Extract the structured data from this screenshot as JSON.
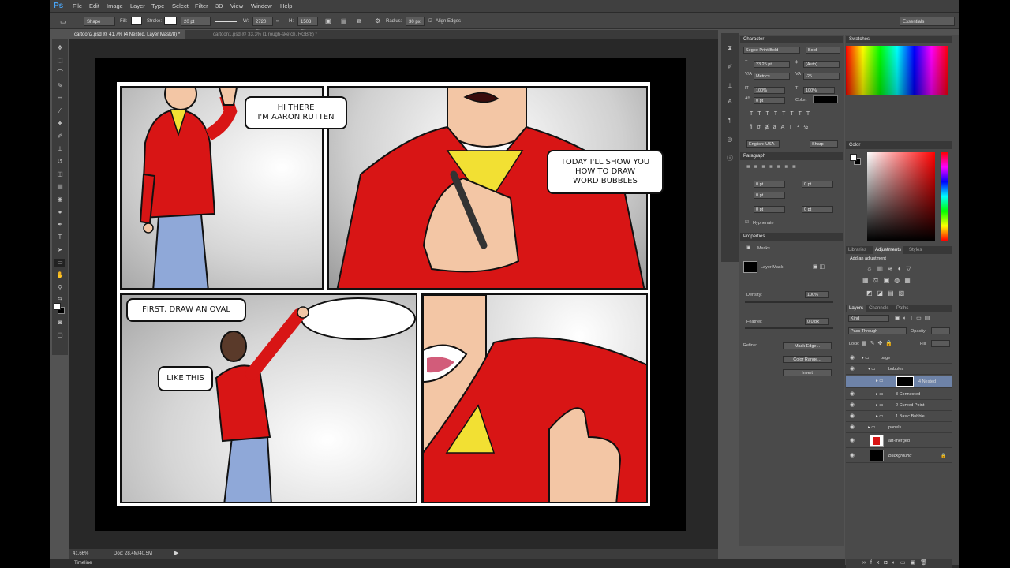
{
  "app": {
    "logo": "Ps",
    "workspace": "Essentials"
  },
  "menu": [
    "File",
    "Edit",
    "Image",
    "Layer",
    "Type",
    "Select",
    "Filter",
    "3D",
    "View",
    "Window",
    "Help"
  ],
  "options": {
    "mode": "Shape",
    "fill_label": "Fill:",
    "stroke_label": "Stroke:",
    "stroke_width": "20 pt",
    "w_label": "W:",
    "w_value": "2720 px",
    "h_label": "H:",
    "h_value": "1503 px",
    "radius_label": "Radius:",
    "radius_value": "30 px",
    "align_edges": "Align Edges"
  },
  "tabs": [
    {
      "label": "cartoon2.psd @ 41.7% (4 Nested, Layer Mask/8) *"
    },
    {
      "label": "cartoon1.psd @ 33.3% (1 rough-sketch, RGB/8) *"
    }
  ],
  "comic": {
    "b1": "HI THERE\nI'M AARON RUTTEN",
    "b2": "TODAY I'LL SHOW YOU\nHOW TO DRAW\nWORD BUBBLES",
    "b3": "FIRST, DRAW AN OVAL",
    "b4": "LIKE THIS"
  },
  "status": {
    "zoom": "41.66%",
    "doc": "Doc: 28.4M/40.5M"
  },
  "timeline": "Timeline",
  "character": {
    "title": "Character",
    "font": "Segoe Print Bold",
    "style": "Bold",
    "size": "23.25 pt",
    "leading": "(Auto)",
    "kerning": "Metrics",
    "tracking": "-25",
    "vscale": "100%",
    "hscale": "100%",
    "baseline": "0 pt",
    "color_label": "Color:",
    "lang": "English: USA",
    "aa": "Sharp"
  },
  "paragraph": {
    "title": "Paragraph",
    "indent1": "0 pt",
    "indent2": "0 pt",
    "indent3": "0 pt",
    "space1": "0 pt",
    "space2": "0 pt",
    "hyphenate": "Hyphenate"
  },
  "properties": {
    "title": "Properties",
    "masks": "Masks",
    "layer_mask": "Layer Mask",
    "density_label": "Density:",
    "density": "100%",
    "feather_label": "Feather:",
    "feather": "0.0 px",
    "refine_label": "Refine:",
    "mask_edge": "Mask Edge...",
    "color_range": "Color Range...",
    "invert": "Invert"
  },
  "swatches": {
    "title": "Swatches"
  },
  "color": {
    "title": "Color"
  },
  "adjust": {
    "tabs": [
      "Libraries",
      "Adjustments",
      "Styles"
    ],
    "add": "Add an adjustment"
  },
  "layers": {
    "tabs": [
      "Layers",
      "Channels",
      "Paths"
    ],
    "kind": "Kind",
    "blend": "Pass Through",
    "opacity_label": "Opacity:",
    "lock_label": "Lock:",
    "fill_label": "Fill:",
    "rows": [
      {
        "name": "page"
      },
      {
        "name": "bubbles"
      },
      {
        "name": "4 Nested"
      },
      {
        "name": "3 Connected"
      },
      {
        "name": "2 Curved Point"
      },
      {
        "name": "1 Basic Bubble"
      },
      {
        "name": "panels"
      },
      {
        "name": "art-merged"
      },
      {
        "name": "Background"
      }
    ]
  }
}
